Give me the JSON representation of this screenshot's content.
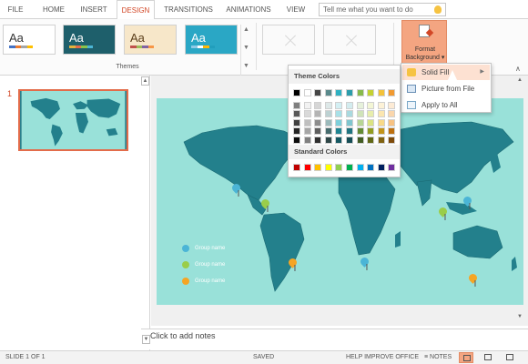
{
  "ribbon_tabs": [
    {
      "label": "FILE",
      "active": false
    },
    {
      "label": "HOME",
      "active": false
    },
    {
      "label": "INSERT",
      "active": false
    },
    {
      "label": "DESIGN",
      "active": true
    },
    {
      "label": "TRANSITIONS",
      "active": false
    },
    {
      "label": "ANIMATIONS",
      "active": false
    },
    {
      "label": "VIEW",
      "active": false
    }
  ],
  "tell_me": {
    "placeholder": "Tell me what you want to do",
    "icon": "lightbulb-icon"
  },
  "themes": {
    "group_label": "Themes",
    "items": [
      {
        "sample": "Aa"
      },
      {
        "sample": "Aa"
      },
      {
        "sample": "Aa"
      },
      {
        "sample": "Aa"
      }
    ]
  },
  "format_background": {
    "label_line1": "Format",
    "label_line2": "Background",
    "icon": "format-background-icon"
  },
  "color_dropdown": {
    "theme_colors_title": "Theme Colors",
    "standard_colors_title": "Standard Colors",
    "theme_columns": [
      [
        "#000000",
        "#7f7f7f",
        "#595959",
        "#404040",
        "#262626",
        "#0d0d0d"
      ],
      [
        "#ffffff",
        "#f2f2f2",
        "#d9d9d9",
        "#bfbfbf",
        "#a6a6a6",
        "#808080"
      ],
      [
        "#454545",
        "#d6d6d6",
        "#b4b4b4",
        "#8c8c8c",
        "#5e5e5e",
        "#2f2f2f"
      ],
      [
        "#5a8a8c",
        "#dde8e8",
        "#bcd1d2",
        "#9bbabb",
        "#476c6e",
        "#2e4647"
      ],
      [
        "#2fb1c2",
        "#d3eff3",
        "#a8e0e7",
        "#7dd0db",
        "#1f8592",
        "#155862"
      ],
      [
        "#2c9dac",
        "#d3ecef",
        "#a9d9df",
        "#7fc6cf",
        "#217581",
        "#164e56"
      ],
      [
        "#88ba4c",
        "#e6f1db",
        "#cfe3b8",
        "#b7d594",
        "#648b34",
        "#435d23"
      ],
      [
        "#c4d132",
        "#f3f6d5",
        "#e7edac",
        "#dbe382",
        "#929d22",
        "#616817"
      ],
      [
        "#f3c23a",
        "#fdf2d7",
        "#fbe6b0",
        "#f8d988",
        "#c2941b",
        "#816312"
      ],
      [
        "#f19a31",
        "#fdebd5",
        "#fad6ac",
        "#f7c283",
        "#bd7010",
        "#7e4b0b"
      ]
    ],
    "standard_colors": [
      "#c00000",
      "#ff0000",
      "#ffc000",
      "#ffff00",
      "#92d050",
      "#00b050",
      "#00b0f0",
      "#0070c0",
      "#002060",
      "#7030a0"
    ]
  },
  "fill_menu": {
    "items": [
      {
        "label": "Solid Fill",
        "icon": "paint-bucket-icon",
        "has_submenu": true,
        "hover": true
      },
      {
        "label": "Picture from File",
        "icon": "picture-icon",
        "has_submenu": false
      },
      {
        "label": "Apply to All",
        "icon": "apply-all-icon",
        "has_submenu": false
      }
    ]
  },
  "thumbnail_pane": {
    "slide_number": "1"
  },
  "slide": {
    "background_color": "#99e1d9",
    "land_color": "#23808c",
    "legend": [
      {
        "label": "Group name",
        "color": "#4bb5d6"
      },
      {
        "label": "Group name",
        "color": "#9acd4a"
      },
      {
        "label": "Group name",
        "color": "#f5a524"
      }
    ]
  },
  "notes": {
    "placeholder": "Click to add notes"
  },
  "status_bar": {
    "slide_info": "SLIDE 1 OF 1",
    "save_state": "SAVED",
    "help": "HELP IMPROVE OFFICE",
    "notes_button": "NOTES"
  },
  "colors": {
    "accent": "#d24726",
    "hover": "#f4a581"
  }
}
